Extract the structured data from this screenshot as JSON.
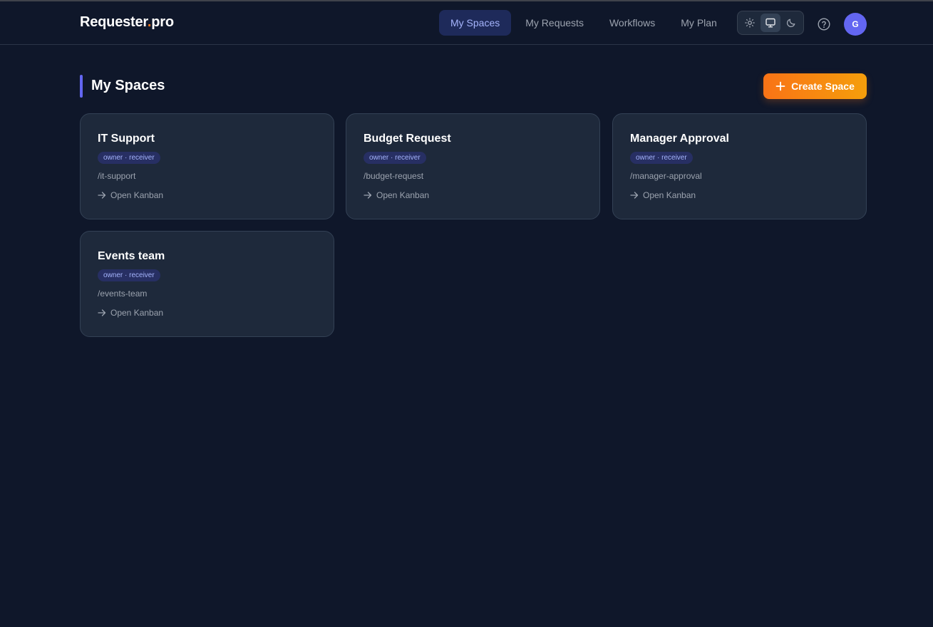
{
  "header": {
    "logo_main": "Requester",
    "logo_dot": ".",
    "logo_suffix": "pro",
    "nav": [
      {
        "label": "My Spaces",
        "active": true
      },
      {
        "label": "My Requests",
        "active": false
      },
      {
        "label": "Workflows",
        "active": false
      },
      {
        "label": "My Plan",
        "active": false
      }
    ],
    "theme_options": [
      "sun-icon",
      "monitor-icon",
      "moon-icon"
    ],
    "theme_selected": "monitor-icon",
    "avatar_initial": "G"
  },
  "main": {
    "title": "My Spaces",
    "create_label": "Create Space",
    "spaces": [
      {
        "name": "IT Support",
        "roles": "owner · receiver",
        "slug": "/it-support",
        "link": "Open Kanban"
      },
      {
        "name": "Budget Request",
        "roles": "owner · receiver",
        "slug": "/budget-request",
        "link": "Open Kanban"
      },
      {
        "name": "Manager Approval",
        "roles": "owner · receiver",
        "slug": "/manager-approval",
        "link": "Open Kanban"
      },
      {
        "name": "Events team",
        "roles": "owner · receiver",
        "slug": "/events-team",
        "link": "Open Kanban"
      }
    ]
  },
  "colors": {
    "background": "#0f172a",
    "card": "#1e293b",
    "accent": "#6366f1",
    "brand_orange": "#f97316"
  }
}
